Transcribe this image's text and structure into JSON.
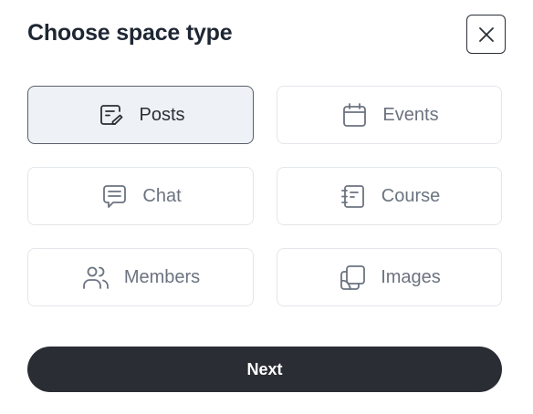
{
  "dialog": {
    "title": "Choose space type",
    "close_icon": "close-icon"
  },
  "space_types": [
    {
      "label": "Posts",
      "icon": "posts-icon",
      "selected": true
    },
    {
      "label": "Events",
      "icon": "calendar-icon",
      "selected": false
    },
    {
      "label": "Chat",
      "icon": "chat-icon",
      "selected": false
    },
    {
      "label": "Course",
      "icon": "course-icon",
      "selected": false
    },
    {
      "label": "Members",
      "icon": "members-icon",
      "selected": false
    },
    {
      "label": "Images",
      "icon": "images-icon",
      "selected": false
    }
  ],
  "footer": {
    "next_label": "Next"
  },
  "colors": {
    "selected_bg": "#eef2f6",
    "primary_button": "#2a2d33"
  }
}
